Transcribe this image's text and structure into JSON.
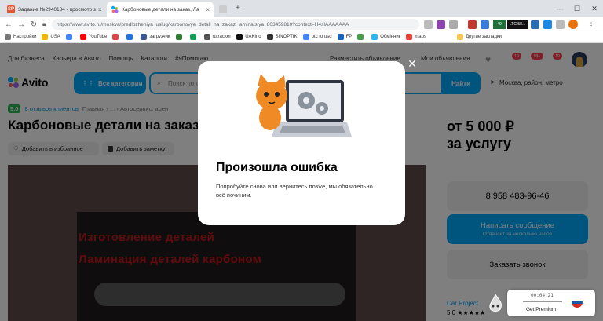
{
  "browser": {
    "tabs": [
      {
        "label": "Задание №2940184 - просмотр з",
        "icon": "sp-icon",
        "active": false
      },
      {
        "label": "Карбоновые детали на заказ, Ла",
        "icon": "avito-icon",
        "active": true
      },
      {
        "label": "",
        "icon": "blank-tab-icon",
        "active": false
      }
    ],
    "url": "https://www.avito.ru/moskva/predlozheniya_uslug/karbonovye_detali_na_zakaz_laminatsiya_803459810?context=H4sIAAAAAAA",
    "bookmarks": [
      "Настройки",
      "USA",
      "",
      "YouTube",
      "",
      "",
      "загрузчик",
      "",
      "",
      "rutracker",
      "UAKino",
      "SINOPTIK",
      "btc to usd",
      "FP",
      "",
      "Обмінник",
      "maps",
      "Другие закладки"
    ],
    "ext_badge_ltc": "LTC 58.1",
    "ext_badge_2": "49"
  },
  "header": {
    "links": [
      "Для бизнеса",
      "Карьера в Авито",
      "Помощь",
      "Каталоги",
      "#яПомогаю"
    ],
    "post_ad": "Разместить объявление",
    "my_ads": "Мои объявления",
    "badge_fav": "19",
    "badge_msg": "99+",
    "badge_cart": "19"
  },
  "logo": "Avito",
  "search": {
    "categories": "Все категории",
    "placeholder": "Поиск по о",
    "find": "Найти",
    "city": "Москва, район, метро"
  },
  "listing": {
    "rating": "5,0",
    "reviews": "8 отзывов клиентов",
    "breadcrumb": "Главная  ›  ...  ›  Автосервис, арен",
    "title": "Карбоновые детали на заказ",
    "fav_label": "Добавить в избранное",
    "note_label": "Добавить заметку",
    "photo_text1": "Изготовление деталей",
    "photo_text2": "Ламинация деталей карбоном",
    "price_line1": "от 5 000 ₽",
    "price_line2": "за услугу",
    "phone": "8 958 483-96-46",
    "msg_btn": "Написать сообщение",
    "msg_sub": "Отвечает за несколько часов",
    "call_btn": "Заказать звонок",
    "seller": "Car Project",
    "seller_rating": "5,0 ★★★★★"
  },
  "modal": {
    "title": "Произошла ошибка",
    "description": "Попробуйте снова или вернитесь позже, мы обязательно всё починим."
  },
  "recorder": {
    "time": "00:04:21",
    "link": "Get Premium"
  }
}
